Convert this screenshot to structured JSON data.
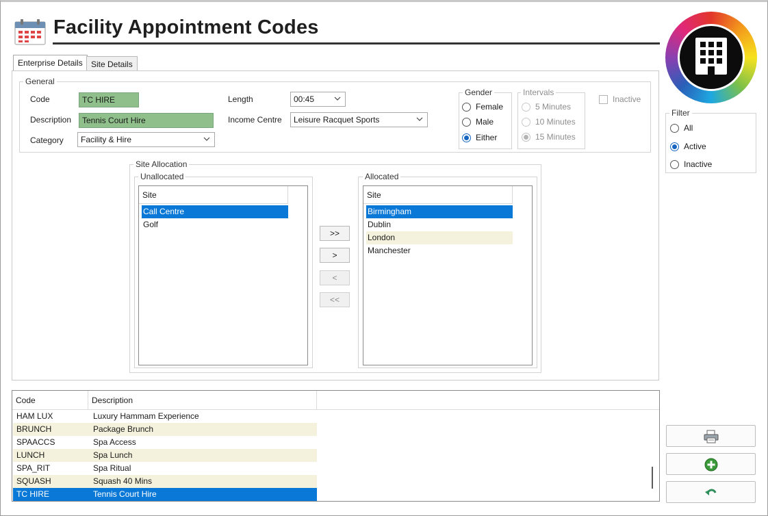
{
  "header": {
    "title": "Facility Appointment Codes"
  },
  "tabs": [
    {
      "label": "Enterprise Details",
      "active": true
    },
    {
      "label": "Site Details",
      "active": false
    }
  ],
  "general": {
    "group_label": "General",
    "code_label": "Code",
    "code_value": "TC HIRE",
    "description_label": "Description",
    "description_value": "Tennis Court Hire",
    "category_label": "Category",
    "category_value": "Facility & Hire",
    "length_label": "Length",
    "length_value": "00:45",
    "income_centre_label": "Income Centre",
    "income_centre_value": "Leisure Racquet Sports",
    "gender": {
      "label": "Gender",
      "options": [
        "Female",
        "Male",
        "Either"
      ],
      "selected": "Either"
    },
    "intervals": {
      "label": "Intervals",
      "options": [
        "5 Minutes",
        "10 Minutes",
        "15 Minutes"
      ],
      "selected": "15 Minutes"
    },
    "inactive_label": "Inactive",
    "inactive_checked": false
  },
  "site_allocation": {
    "label": "Site Allocation",
    "unallocated": {
      "label": "Unallocated",
      "column_header": "Site",
      "items": [
        "Call Centre",
        "Golf"
      ],
      "selected": "Call Centre"
    },
    "allocated": {
      "label": "Allocated",
      "column_header": "Site",
      "items": [
        "Birmingham",
        "Dublin",
        "London",
        "Manchester"
      ],
      "selected": "Birmingham"
    },
    "buttons": {
      "add_all": ">>",
      "add": ">",
      "remove": "<",
      "remove_all": "<<"
    }
  },
  "grid": {
    "columns": [
      "Code",
      "Description"
    ],
    "rows": [
      {
        "code": "HAM LUX",
        "description": "Luxury Hammam Experience"
      },
      {
        "code": "BRUNCH",
        "description": "Package Brunch"
      },
      {
        "code": "SPAACCS",
        "description": "Spa Access"
      },
      {
        "code": "LUNCH",
        "description": "Spa Lunch"
      },
      {
        "code": "SPA_RIT",
        "description": "Spa Ritual"
      },
      {
        "code": "SQUASH",
        "description": "Squash 40 Mins"
      },
      {
        "code": "TC HIRE",
        "description": "Tennis Court Hire"
      }
    ],
    "selected_code": "TC HIRE"
  },
  "filter": {
    "label": "Filter",
    "options": [
      "All",
      "Active",
      "Inactive"
    ],
    "selected": "Active"
  },
  "actions": {
    "icons": [
      "printer-icon",
      "add-icon",
      "undo-icon"
    ]
  },
  "colors": {
    "selection": "#0a78d7",
    "alt_row": "#f4f1dc",
    "code_field_bg": "#8fbf8a"
  }
}
